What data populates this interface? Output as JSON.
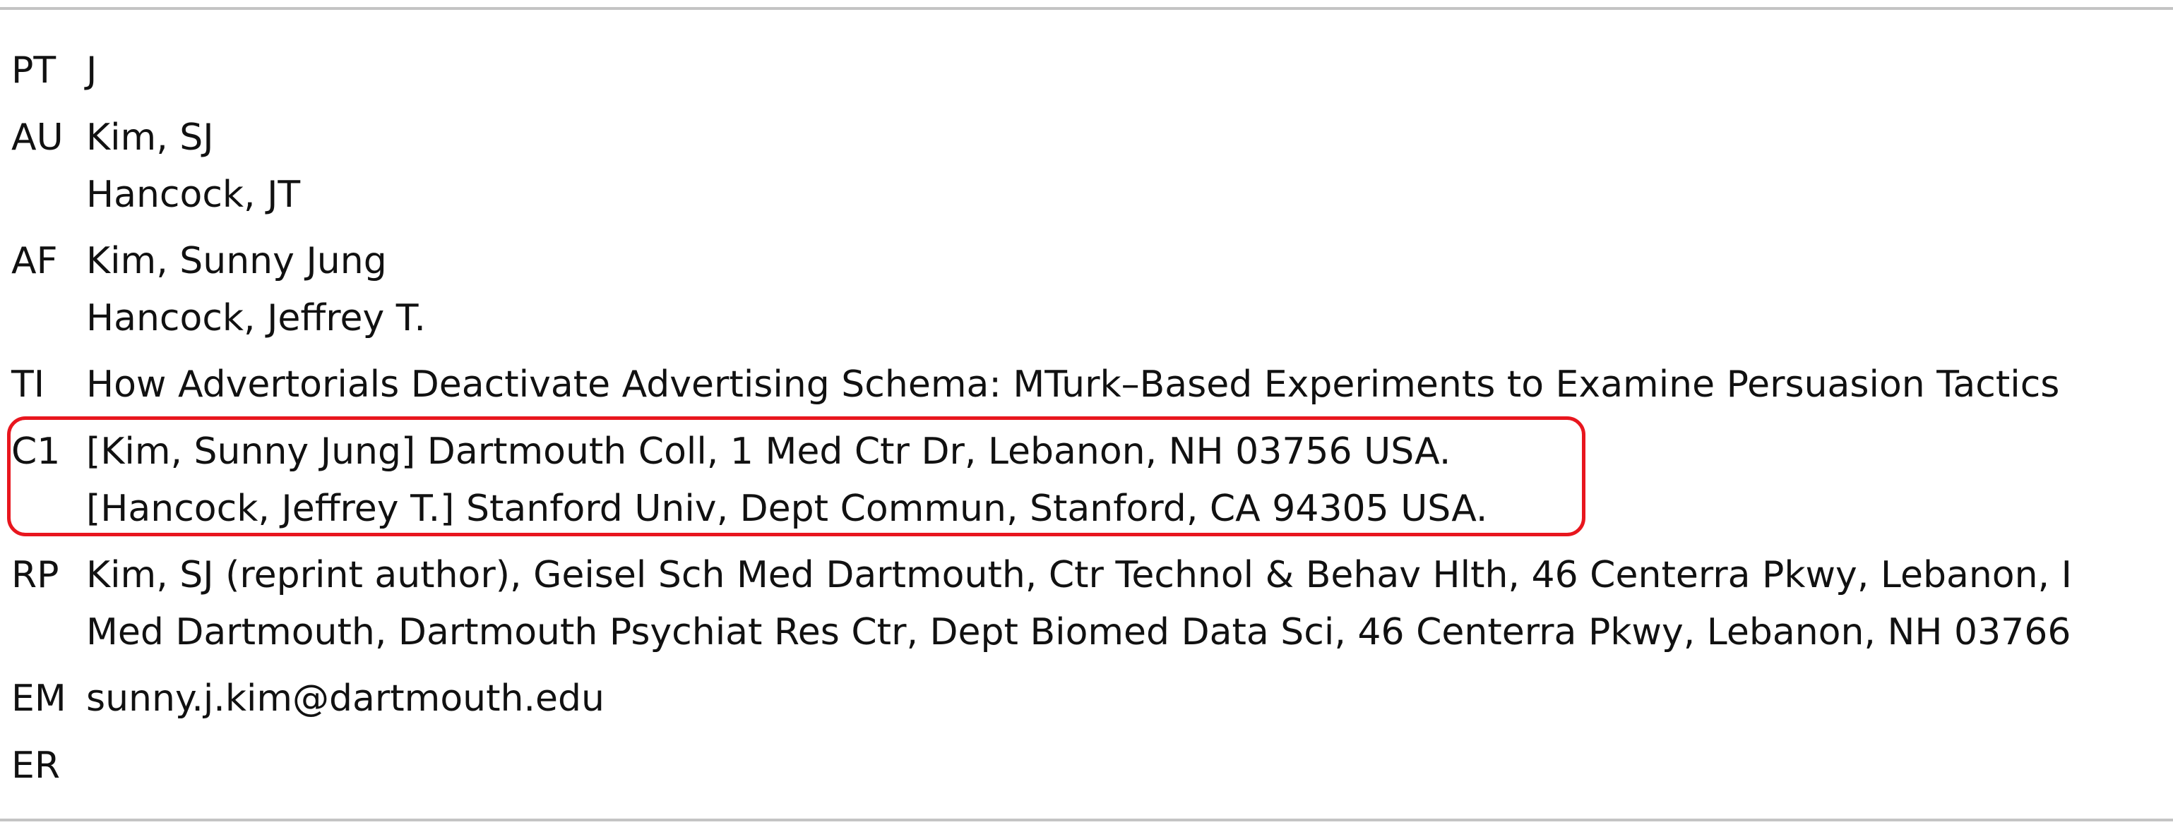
{
  "record": {
    "fields": [
      {
        "tag": "PT",
        "lines": [
          "J"
        ]
      },
      {
        "tag": "AU",
        "lines": [
          "Kim, SJ",
          "Hancock, JT"
        ]
      },
      {
        "tag": "AF",
        "lines": [
          "Kim, Sunny Jung",
          "Hancock, Jeffrey T."
        ]
      },
      {
        "tag": "TI",
        "lines": [
          "How Advertorials Deactivate Advertising Schema: MTurk–Based Experiments to Examine Persuasion Tactics"
        ]
      },
      {
        "tag": "C1",
        "lines": [
          "[Kim, Sunny Jung] Dartmouth Coll, 1 Med Ctr Dr, Lebanon, NH 03756 USA.",
          "[Hancock, Jeffrey T.] Stanford Univ, Dept Commun, Stanford, CA 94305 USA."
        ]
      },
      {
        "tag": "RP",
        "lines": [
          "Kim, SJ (reprint author), Geisel Sch Med Dartmouth, Ctr Technol & Behav Hlth, 46 Centerra Pkwy, Lebanon, I",
          "Med Dartmouth, Dartmouth Psychiat Res Ctr, Dept Biomed Data Sci, 46 Centerra Pkwy, Lebanon, NH 03766"
        ]
      },
      {
        "tag": "EM",
        "lines": [
          "sunny.j.kim@dartmouth.edu"
        ]
      },
      {
        "tag": "ER",
        "lines": []
      }
    ]
  },
  "highlight": {
    "field": "C1",
    "color": "#e8161e"
  },
  "colors": {
    "text": "#111111",
    "rule": "#c4c4c4",
    "background": "#ffffff"
  }
}
